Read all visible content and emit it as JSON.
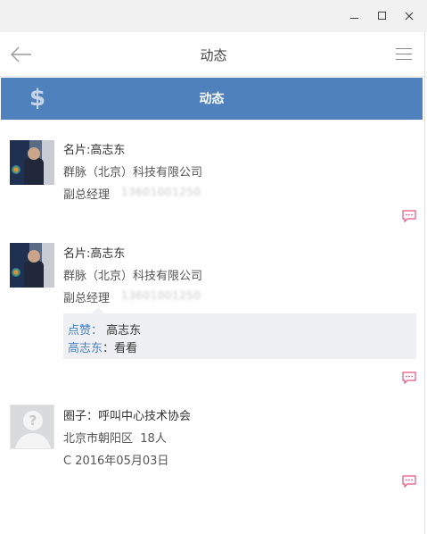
{
  "window": {
    "minimize_label": "minimize",
    "maximize_label": "maximize",
    "close_label": "close"
  },
  "header": {
    "title": "动态",
    "back_icon": "arrow-left-icon",
    "menu_icon": "hamburger-menu-icon"
  },
  "banner": {
    "icon": "dollar-icon",
    "glyph": "$",
    "title": "动态",
    "color": "#4f81bd"
  },
  "feed": [
    {
      "title": "名片:高志东",
      "company": "群脉（北京）科技有限公司",
      "position": "副总经理",
      "phone_masked": "13601001250"
    },
    {
      "title": "名片:高志东",
      "company": "群脉（北京）科技有限公司",
      "position": "副总经理",
      "phone_masked": "13601001250",
      "likes_label": "点赞：",
      "likes_names": "高志东",
      "comment_author": "高志东",
      "comment_text": "：看看"
    },
    {
      "title": "圈子：呼叫中心技术协会",
      "location": "北京市朝阳区",
      "members": "18人",
      "date_line": "C  2016年05月03日"
    }
  ],
  "colors": {
    "accent_blue": "#4a7fc1",
    "comment_icon": "#e75480"
  }
}
